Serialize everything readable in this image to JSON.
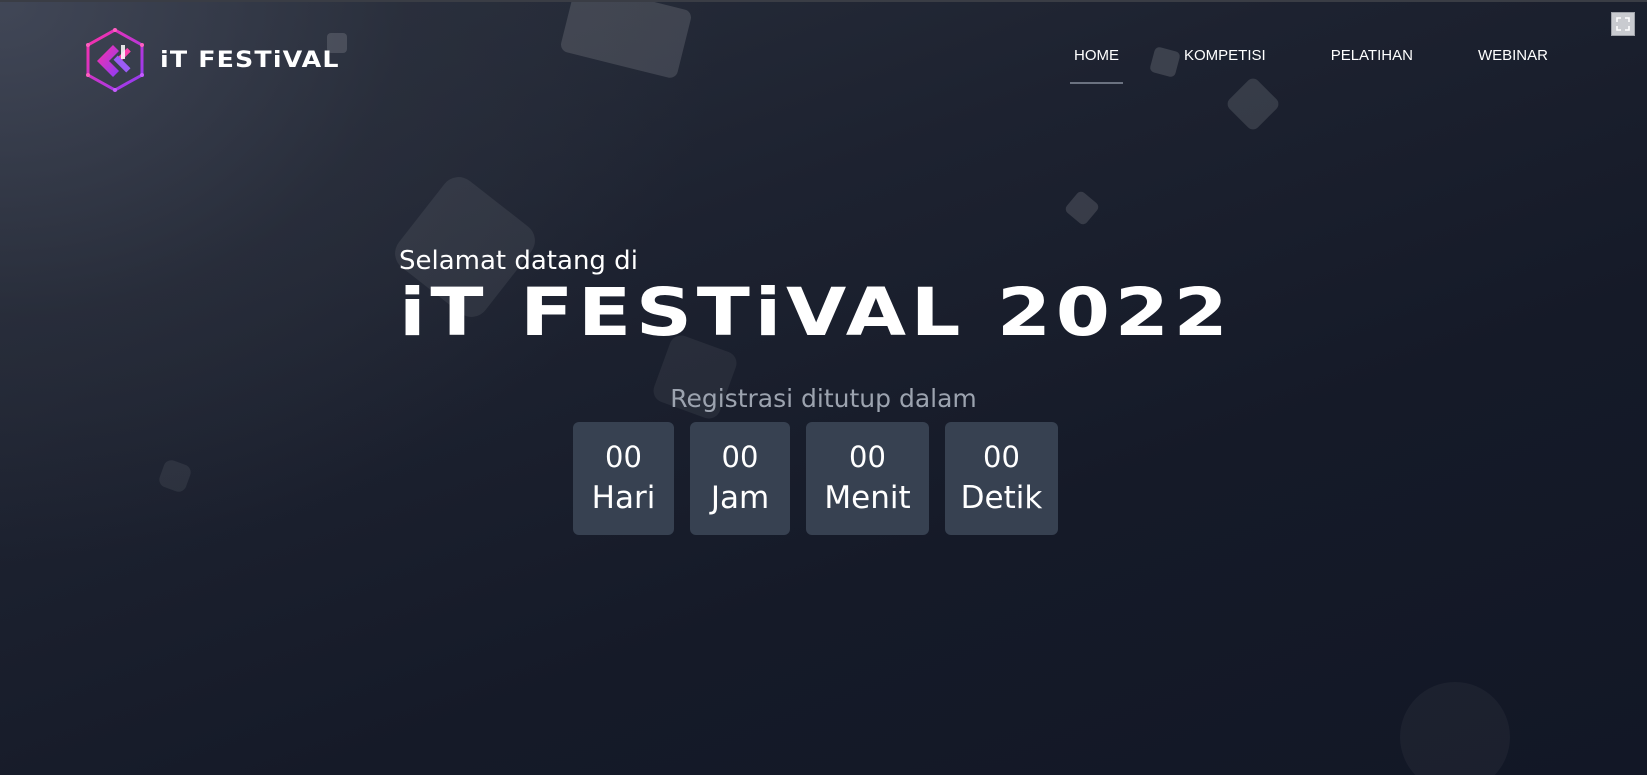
{
  "brand": {
    "name": "iT FESTiVAL",
    "logo_icon": "it-festival-hexagon-logo",
    "accent_colors": [
      "#e11d8f",
      "#7c3aed"
    ]
  },
  "nav": {
    "items": [
      {
        "label": "HOME",
        "active": true
      },
      {
        "label": "KOMPETISI",
        "active": false
      },
      {
        "label": "PELATIHAN",
        "active": false
      },
      {
        "label": "WEBINAR",
        "active": false
      }
    ]
  },
  "hero": {
    "greeting": "Selamat datang di",
    "title": "iT FESTiVAL 2022"
  },
  "countdown": {
    "label": "Registrasi ditutup dalam",
    "units": [
      {
        "value": "00",
        "unit": "Hari"
      },
      {
        "value": "00",
        "unit": "Jam"
      },
      {
        "value": "00",
        "unit": "Menit"
      },
      {
        "value": "00",
        "unit": "Detik"
      }
    ],
    "box_color": "#374151"
  },
  "controls": {
    "expand_icon": "expand-icon"
  }
}
